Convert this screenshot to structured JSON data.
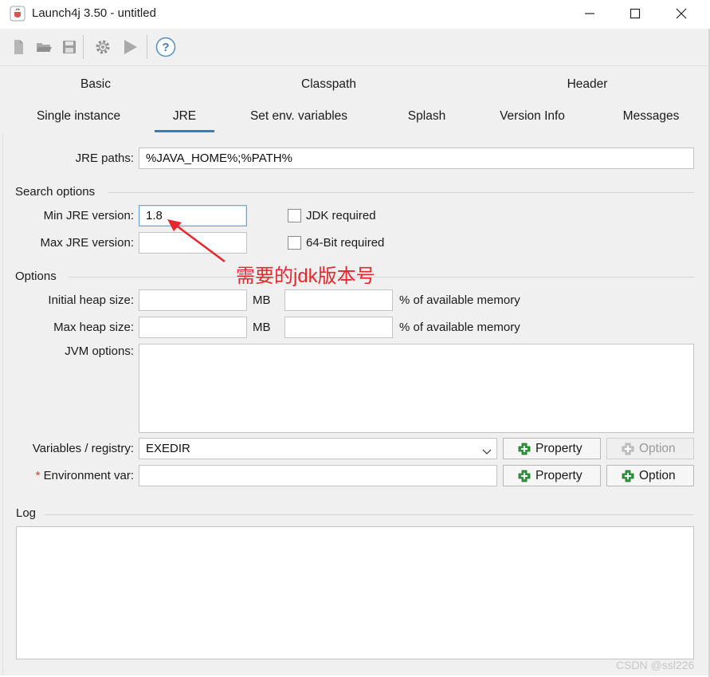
{
  "window": {
    "title": "Launch4j 3.50 - untitled"
  },
  "toolbar": {
    "buttons": [
      "new-icon",
      "open-icon",
      "save-icon",
      "settings-icon",
      "run-icon",
      "help-icon"
    ]
  },
  "tabs": {
    "row1": [
      "Basic",
      "Classpath",
      "Header"
    ],
    "row2": [
      "Single instance",
      "JRE",
      "Set env. variables",
      "Splash",
      "Version Info",
      "Messages"
    ],
    "active": "JRE"
  },
  "jre": {
    "paths_label": "JRE paths:",
    "paths_value": "%JAVA_HOME%;%PATH%",
    "search_options_title": "Search options",
    "min_version_label": "Min JRE version:",
    "min_version_value": "1.8",
    "max_version_label": "Max JRE version:",
    "max_version_value": "",
    "jdk_required_label": "JDK required",
    "bit64_required_label": "64-Bit required",
    "options_title": "Options",
    "initial_heap_label": "Initial heap size:",
    "max_heap_label": "Max heap size:",
    "mb_label": "MB",
    "percent_label": "% of available memory",
    "jvm_options_label": "JVM options:",
    "variables_label": "Variables / registry:",
    "variables_value": "EXEDIR",
    "env_var_required_mark": "*",
    "env_var_label": "Environment var:",
    "property_button": "Property",
    "option_button": "Option"
  },
  "log": {
    "title": "Log"
  },
  "annotation": {
    "text": "需要的jdk版本号",
    "color": "#e8262b"
  },
  "watermark": {
    "text": "CSDN @ssl226"
  },
  "colors": {
    "accent": "#2f7fc1",
    "plus_green": "#2e9a3a"
  }
}
